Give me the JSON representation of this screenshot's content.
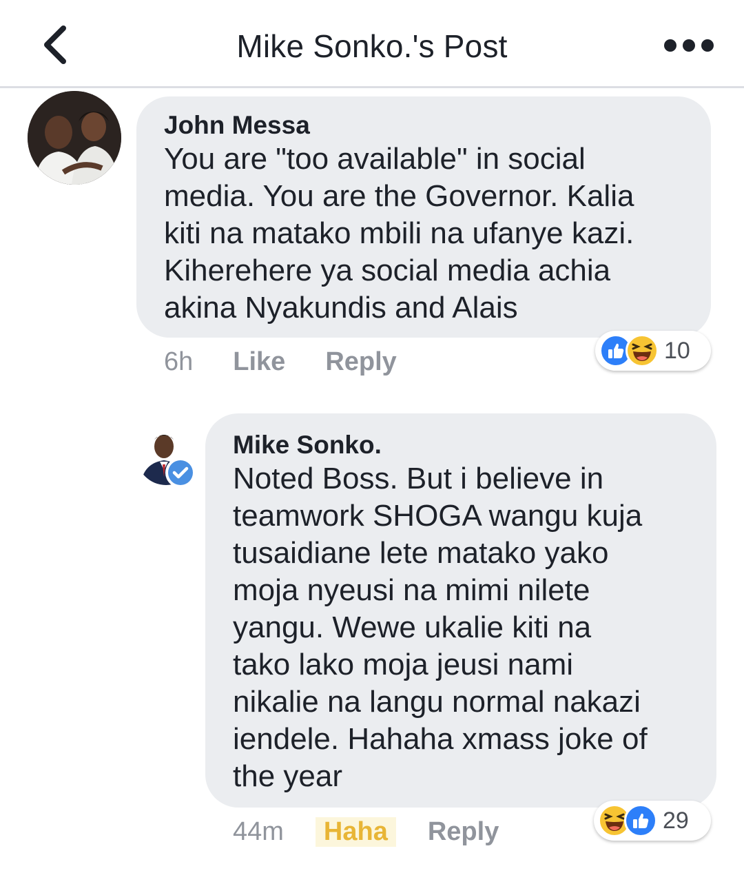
{
  "header": {
    "title": "Mike Sonko.'s Post"
  },
  "comments": [
    {
      "author": "John Messa",
      "lines": [
        "You are \"too available\" in social",
        "media. You are the Governor. Kalia",
        "kiti na matako mbili na ufanye kazi.",
        "Kiherehere ya social media achia",
        "akina Nyakundis and Alais"
      ],
      "time": "6h",
      "like_label": "Like",
      "reply_label": "Reply",
      "reaction_icons": [
        "like-icon",
        "haha-icon"
      ],
      "reaction_count": "10"
    },
    {
      "author": "Mike Sonko.",
      "verified": true,
      "lines": [
        "Noted Boss. But i believe in",
        "teamwork SHOGA wangu kuja",
        "tusaidiane lete matako yako",
        "moja nyeusi na mimi nilete",
        "yangu. Wewe ukalie kiti na",
        "tako lako moja jeusi nami",
        "nikalie na langu normal nakazi",
        "iendele. Hahaha xmass joke of",
        "the year"
      ],
      "time": "44m",
      "reacted_label": "Haha",
      "reply_label": "Reply",
      "reaction_icons": [
        "haha-icon",
        "like-icon"
      ],
      "reaction_count": "29"
    }
  ],
  "colors": {
    "bubble": "#ebedf0",
    "action_text": "#90949c",
    "like_blue": "#2d7ff9",
    "haha_yellow": "#f7c433",
    "haha_label": "#e8b536",
    "verified_blue": "#4a90e2"
  }
}
